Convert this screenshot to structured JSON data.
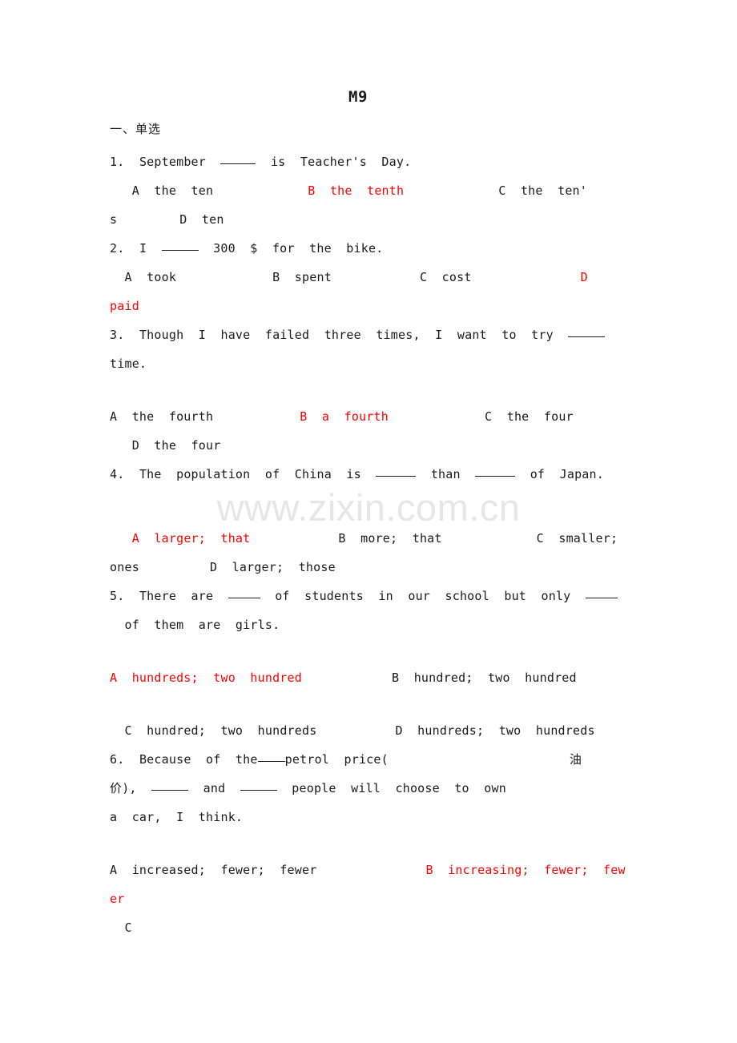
{
  "document": {
    "title": "M9",
    "watermark": "www.zixin.com.cn",
    "section_heading": "一、单选"
  },
  "questions": [
    {
      "number": "1.",
      "stem_before": "September",
      "stem_after": "is  Teacher's  Day.",
      "options_line_1_a": "A  the  ten",
      "options_line_1_b": "B  the  tenth",
      "options_line_1_c": "C  the  ten'",
      "options_line_2_wrap": "s",
      "options_line_2_d": "D  ten"
    },
    {
      "number": "2.",
      "stem_before": "I",
      "stem_after": "300  $  for  the  bike.",
      "opt_a": "A  took",
      "opt_b": "B  spent",
      "opt_c": "C  cost",
      "opt_d_letter": "D",
      "opt_d_wrap": "paid"
    },
    {
      "number": "3.",
      "stem_before": "Though  I  have  failed  three  times,  I  want  to  try",
      "stem_after": "time.",
      "opt_a": "A  the  fourth",
      "opt_b": "B  a  fourth",
      "opt_c": "C  the  four",
      "opt_d": "D  the  four"
    },
    {
      "number": "4.",
      "stem_p1": "The  population  of  China  is",
      "stem_p2": "than",
      "stem_p3": "of  Japan.",
      "opt_a": "A  larger;  that",
      "opt_b": "B  more;  that",
      "opt_c": "C  smaller;",
      "opt_c_wrap": "ones",
      "opt_d": "D  larger;  those"
    },
    {
      "number": "5.",
      "stem_p1": "There  are",
      "stem_p2": "of  students  in  our  school  but  only",
      "stem_p3": "of  them  are  girls.",
      "opt_a": "A  hundreds;  two  hundred",
      "opt_b": "B  hundred;  two  hundred",
      "opt_c": "C  hundred;  two  hundreds",
      "opt_d": "D  hundreds;  two  hundreds"
    },
    {
      "number": "6.",
      "stem_p1": "Because  of  the",
      "stem_p2": "petrol  price(",
      "stem_cn_right": "油",
      "stem_p3": "价),",
      "stem_p4": "and",
      "stem_p5": "people  will  choose  to  own",
      "stem_p6": "a  car,  I  think.",
      "opt_a": "A  increased;  fewer;  fewer",
      "opt_b": "B  increasing;  fewer;  few",
      "opt_b_wrap": "er",
      "opt_c": "C"
    }
  ],
  "colors": {
    "answer_red": "#ff0000",
    "text_black": "#1a1a1a",
    "watermark_gray": "#e6e6e6"
  }
}
